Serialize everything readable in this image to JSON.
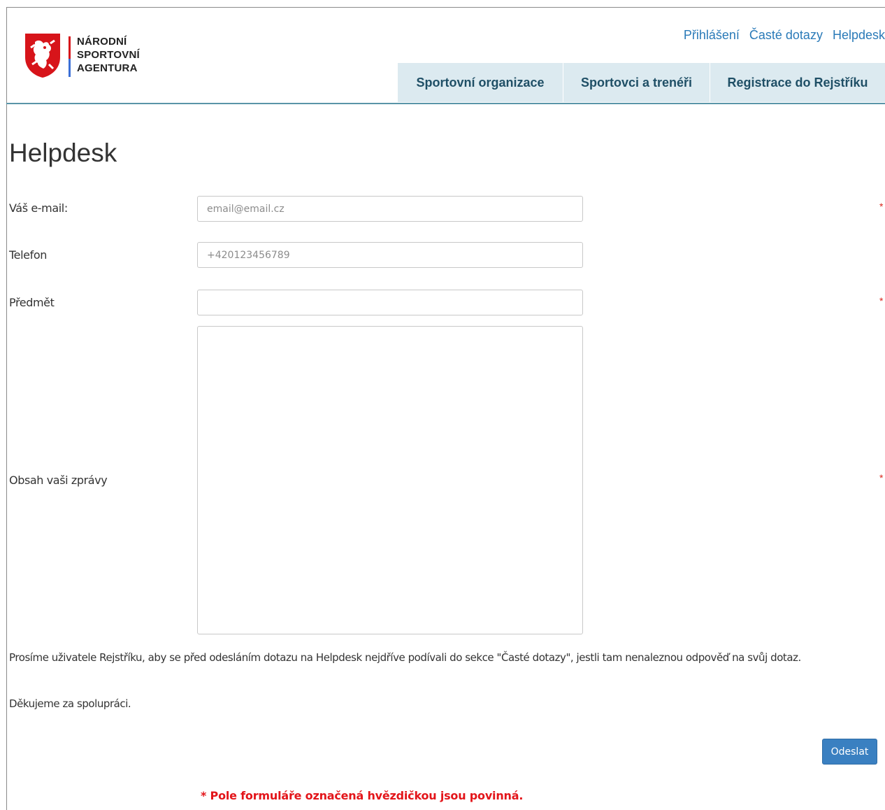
{
  "logo": {
    "line1": "NÁRODNÍ",
    "line2": "SPORTOVNÍ",
    "line3": "AGENTURA",
    "shield_color": "#d7141a",
    "accent_color": "#3b6fd6"
  },
  "top_links": [
    {
      "label": "Přihlášení"
    },
    {
      "label": "Časté dotazy"
    },
    {
      "label": "Helpdesk"
    }
  ],
  "nav": [
    {
      "label": "Sportovní organizace"
    },
    {
      "label": "Sportovci a trenéři"
    },
    {
      "label": "Registrace do Rejstříku"
    }
  ],
  "page": {
    "title": "Helpdesk"
  },
  "form": {
    "email": {
      "label": "Váš e-mail:",
      "placeholder": "email@email.cz",
      "value": "",
      "required_mark": "*"
    },
    "phone": {
      "label": "Telefon",
      "placeholder": "+420123456789",
      "value": ""
    },
    "subject": {
      "label": "Předmět",
      "placeholder": "",
      "value": "",
      "required_mark": "*"
    },
    "message": {
      "label": "Obsah vaši zprávy",
      "placeholder": "",
      "value": "",
      "required_mark": "*"
    },
    "info_text": "Prosíme uživatele Rejstříku, aby se před odesláním dotazu na Helpdesk nejdříve podívali do sekce \"Časté dotazy\", jestli tam nenaleznou odpověď na svůj dotaz.",
    "thanks_text": "Děkujeme za spolupráci.",
    "submit_label": "Odeslat",
    "required_note": "* Pole formuláře označená hvězdičkou jsou povinná."
  },
  "colors": {
    "link": "#2a7ab8",
    "nav_bg": "#dceaf0",
    "nav_text": "#1f4f66",
    "button": "#3a80c1",
    "required": "#e3151a"
  }
}
